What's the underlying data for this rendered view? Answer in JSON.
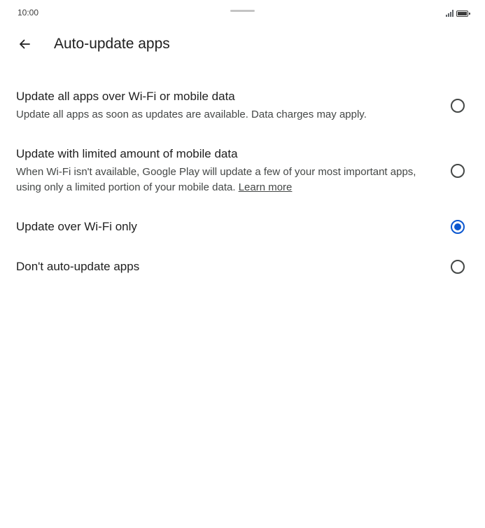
{
  "status_bar": {
    "time": "10:00"
  },
  "header": {
    "title": "Auto-update apps"
  },
  "options": [
    {
      "title": "Update all apps over Wi-Fi or mobile data",
      "description": "Update all apps as soon as updates are available. Data charges may apply.",
      "selected": false
    },
    {
      "title": "Update with limited amount of mobile data",
      "description": "When Wi-Fi isn't available, Google Play will update a few of your most important apps, using only a limited portion of your mobile data.",
      "link": "Learn more",
      "selected": false
    },
    {
      "title": "Update over Wi-Fi only",
      "selected": true
    },
    {
      "title": "Don't auto-update apps",
      "selected": false
    }
  ],
  "colors": {
    "accent": "#0b57d0",
    "text_primary": "#1f1f1f",
    "text_secondary": "#444746"
  },
  "icons": {
    "back": "arrow-left-icon",
    "signal": "signal-icon",
    "battery": "battery-icon"
  }
}
